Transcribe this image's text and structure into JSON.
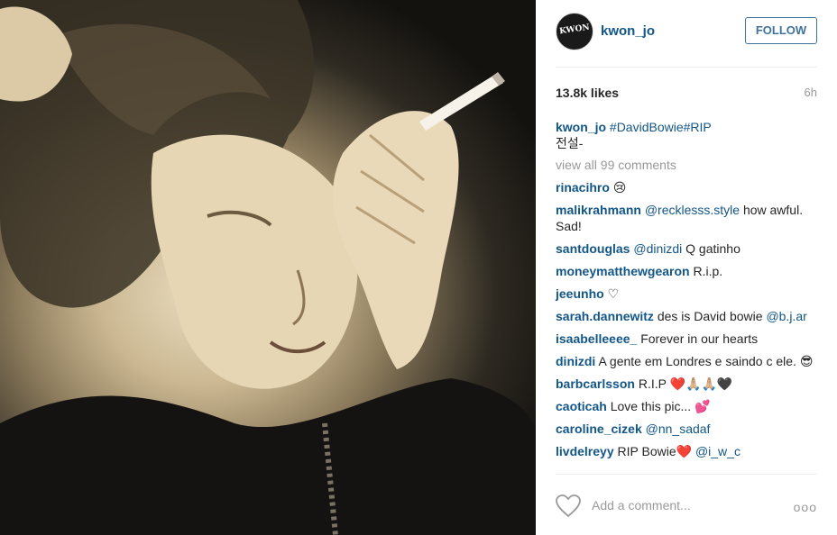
{
  "header": {
    "avatar_text": "KWON",
    "username": "kwon_jo",
    "follow_label": "FOLLOW"
  },
  "stats": {
    "likes": "13.8k likes",
    "time": "6h"
  },
  "caption": {
    "user": "kwon_jo",
    "tags": "#DavidBowie#RIP",
    "text": "전설-"
  },
  "view_all": "view all 99 comments",
  "comments": [
    {
      "user": "rinacihro",
      "text": "😢"
    },
    {
      "user": "malikrahmann",
      "mention": "@recklesss.style",
      "text": "how awful. Sad!"
    },
    {
      "user": "santdouglas",
      "mention": "@dinizdi",
      "text": "Q gatinho"
    },
    {
      "user": "moneymatthewgearon",
      "text": "R.i.p."
    },
    {
      "user": "jeeunho",
      "text": "♡"
    },
    {
      "user": "sarah.dannewitz",
      "text": "des is David bowie",
      "mention_after": "@b.j.ar"
    },
    {
      "user": "isaabelleeee_",
      "text": "Forever in our hearts"
    },
    {
      "user": "dinizdi",
      "text": "A gente em Londres e saindo c ele. 😎"
    },
    {
      "user": "barbcarlsson",
      "text": "R.I.P ❤️🙏🏼🙏🏼🖤"
    },
    {
      "user": "caoticah",
      "text": "Love this pic... 💕"
    },
    {
      "user": "caroline_cizek",
      "mention": "@nn_sadaf",
      "text": ""
    },
    {
      "user": "livdelreyy",
      "text": "RIP Bowie❤️",
      "mention_after": "@i_w_c"
    }
  ],
  "footer": {
    "add_comment_placeholder": "Add a comment...",
    "more_label": "ooo"
  },
  "colors": {
    "link": "#125688",
    "follow": "#3f729b",
    "muted": "#999999"
  }
}
